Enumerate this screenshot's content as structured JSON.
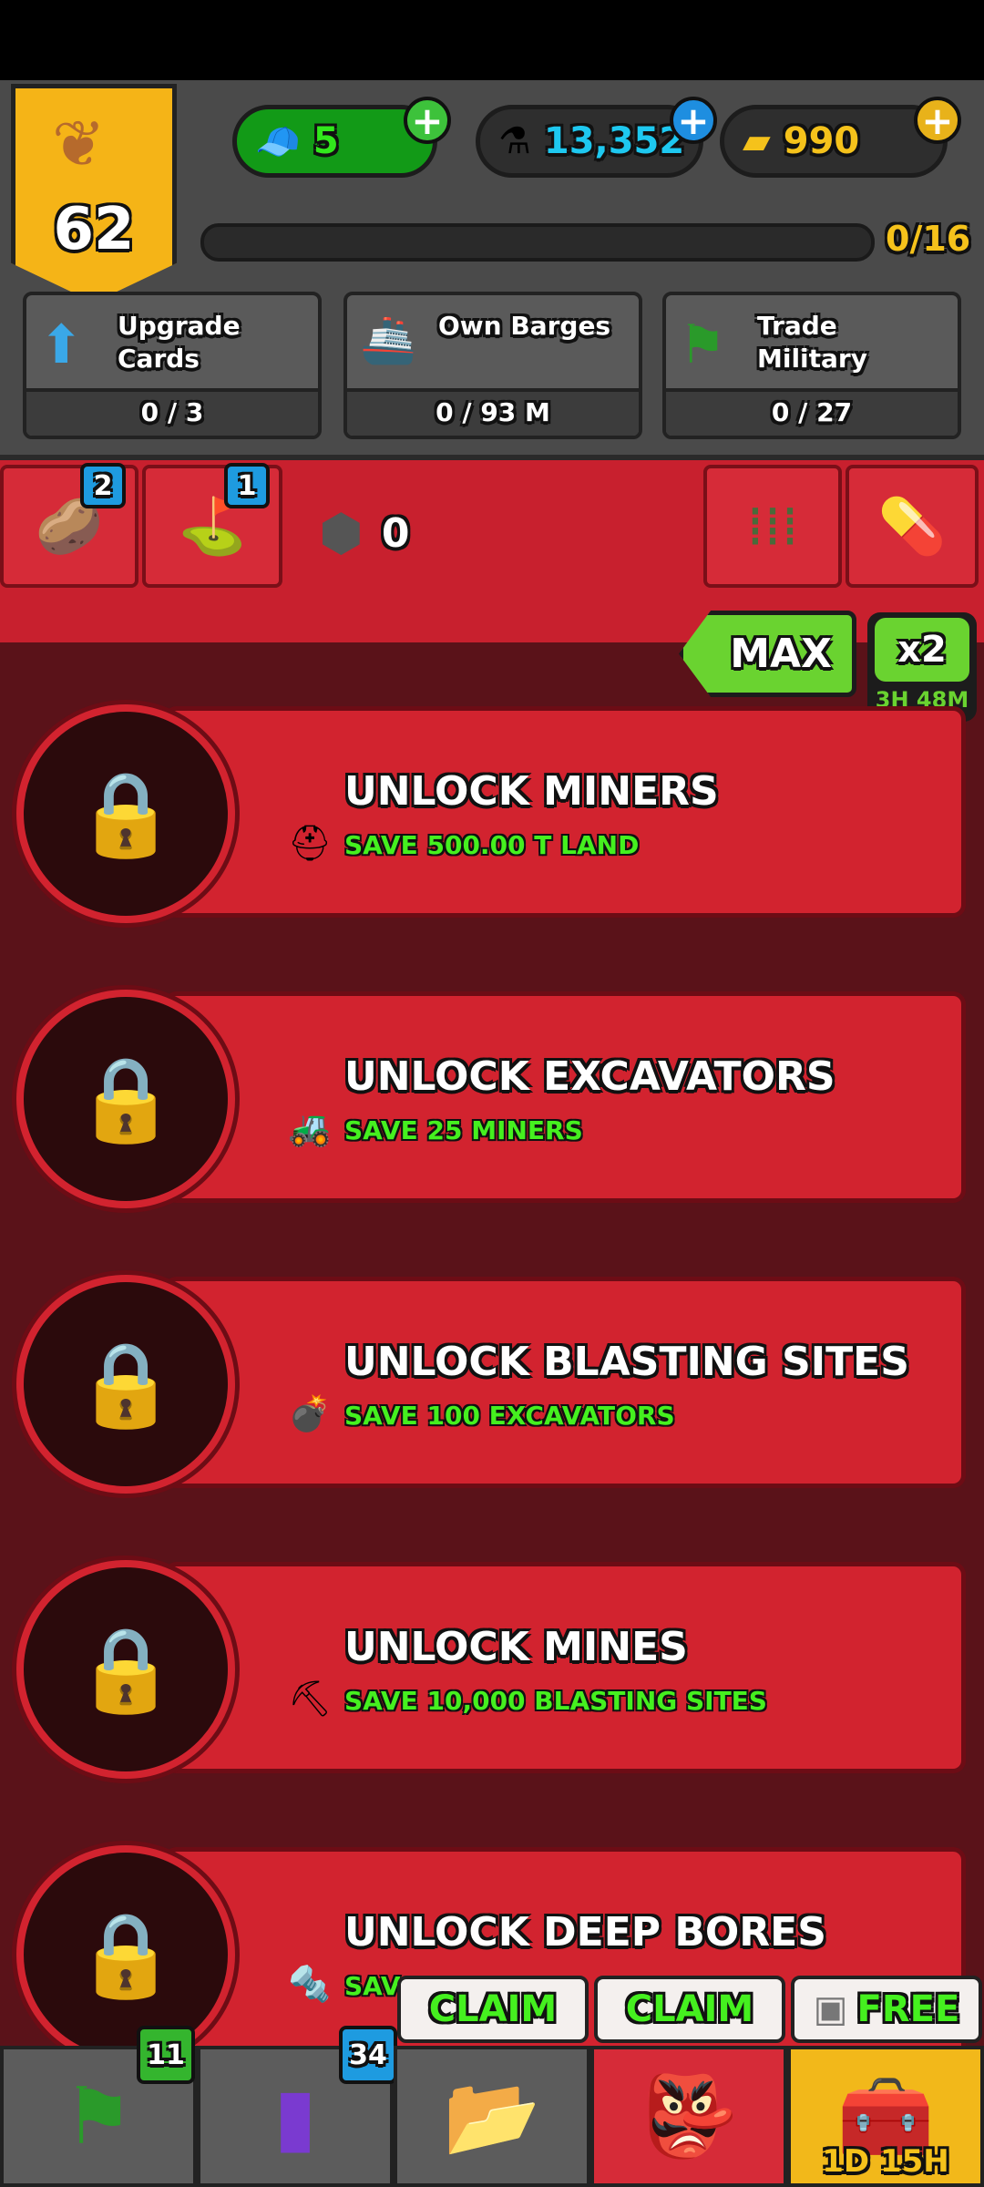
{
  "header": {
    "level": "62",
    "currencies": [
      {
        "name": "soldiers",
        "value": "5",
        "icon": "army-cap-icon",
        "color": "#31e81c"
      },
      {
        "name": "research",
        "value": "13,352",
        "icon": "flask-icon",
        "color": "#1ec8f0"
      },
      {
        "name": "gold",
        "value": "990",
        "icon": "gold-bar-icon",
        "color": "#f5c21b"
      }
    ],
    "progress": {
      "label": "0/16",
      "current": 0,
      "total": 16
    },
    "goals": [
      {
        "label": "Upgrade Cards",
        "value": "0 / 3",
        "icon": "up-arrow-icon"
      },
      {
        "label": "Own Barges",
        "value": "0 / 93 M",
        "icon": "barge-icon"
      },
      {
        "label": "Trade Military",
        "value": "0 / 27",
        "icon": "military-flag-icon"
      }
    ]
  },
  "resource_tabs": [
    {
      "icon": "potato-icon",
      "badge": "2"
    },
    {
      "icon": "land-icon",
      "badge": "1"
    },
    {
      "icon": "ore-icon",
      "value": "0"
    },
    {
      "icon": "ammo-icon"
    },
    {
      "icon": "pill-icon"
    }
  ],
  "max_label": "MAX",
  "boost": {
    "label": "x2",
    "timer": "3H 48M"
  },
  "unlocks": [
    {
      "title": "UNLOCK MINERS",
      "requirement": "SAVE 500.00 T LAND",
      "icon": "miner-helmet-icon"
    },
    {
      "title": "UNLOCK EXCAVATORS",
      "requirement": "SAVE 25 MINERS",
      "icon": "excavator-icon"
    },
    {
      "title": "UNLOCK BLASTING SITES",
      "requirement": "SAVE 100 EXCAVATORS",
      "icon": "bomb-icon"
    },
    {
      "title": "UNLOCK MINES",
      "requirement": "SAVE 10,000 BLASTING SITES",
      "icon": "pickaxe-icon"
    },
    {
      "title": "UNLOCK DEEP BORES",
      "requirement": "SAV",
      "icon": "drill-icon"
    }
  ],
  "bottom_nav": [
    {
      "name": "military",
      "badge": "11",
      "icon": "flag-icon"
    },
    {
      "name": "cards",
      "badge": "34",
      "icon": "cards-icon"
    },
    {
      "name": "missions",
      "bubble": "CLAIM",
      "icon": "folder-icon"
    },
    {
      "name": "boss",
      "bubble": "CLAIM",
      "icon": "villain-mask-icon"
    },
    {
      "name": "chest",
      "bubble": "FREE",
      "timer": "1D 15H",
      "icon": "treasure-chest-icon"
    }
  ]
}
